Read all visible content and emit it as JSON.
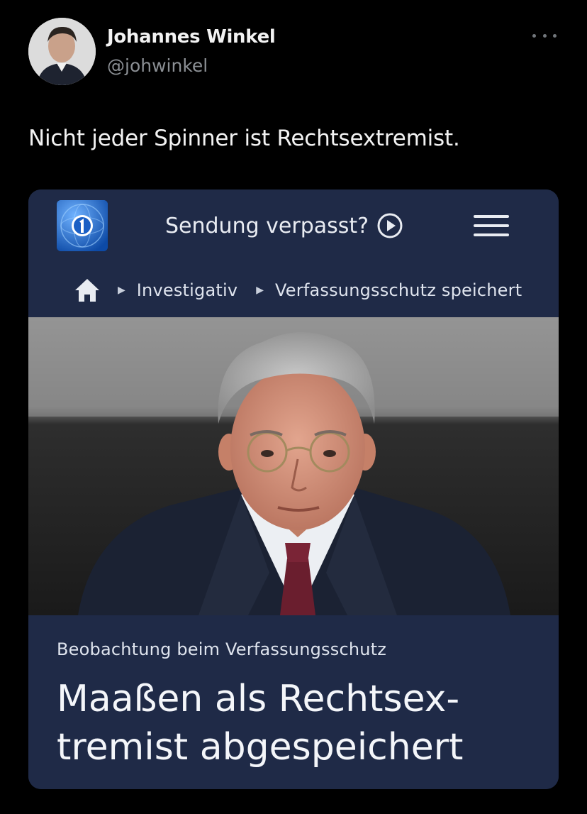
{
  "tweet": {
    "author_name": "Johannes Winkel",
    "author_handle": "@johwinkel",
    "text": "Nicht jeder Spinner ist Rechtsextremist."
  },
  "card": {
    "site_logo": "ard-tagesschau-logo",
    "sendung_label": "Sendung verpasst?",
    "breadcrumb": [
      "Investigativ",
      "Verfassungsschutz speichert"
    ],
    "kicker": "Beobachtung beim Verfassungsschutz",
    "headline_lines": [
      "Maaßen als Rechtsex-",
      "tremist abgespeichert"
    ]
  },
  "colors": {
    "background": "#000000",
    "card_bg": "#1f2a47",
    "handle": "#8b8f94",
    "logo_blue": "#1e66c8"
  }
}
